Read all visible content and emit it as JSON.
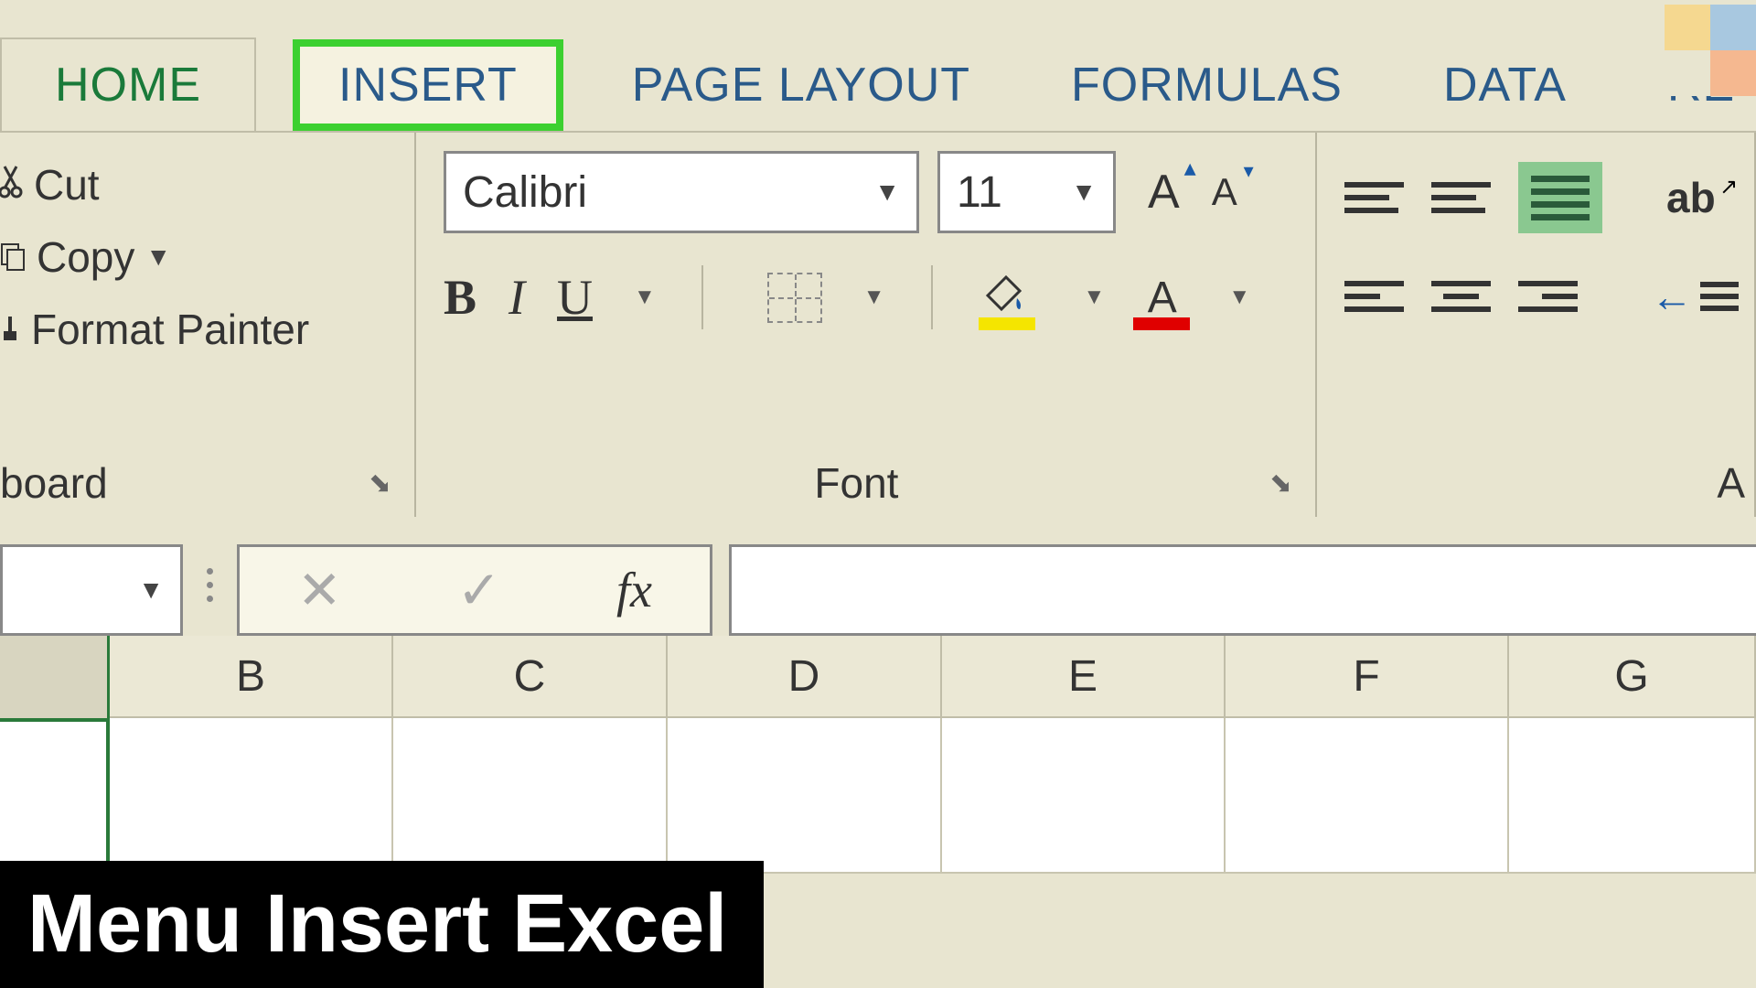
{
  "tabs": {
    "home": "HOME",
    "insert": "INSERT",
    "page_layout": "PAGE LAYOUT",
    "formulas": "FORMULAS",
    "data": "DATA",
    "partial": "RE"
  },
  "clipboard": {
    "cut": "Cut",
    "copy": "Copy",
    "format_painter": "Format Painter",
    "label": "board"
  },
  "font": {
    "name": "Calibri",
    "size": "11",
    "label": "Font",
    "bold": "B",
    "italic": "I",
    "underline": "U",
    "font_color_letter": "A",
    "grow_font": "A",
    "shrink_font": "A"
  },
  "alignment": {
    "label": "A",
    "orientation": "ab"
  },
  "columns": {
    "b": "B",
    "c": "C",
    "d": "D",
    "e": "E",
    "f": "F",
    "g": "G"
  },
  "formula_bar": {
    "fx": "fx"
  },
  "overlay": "Menu Insert Excel"
}
